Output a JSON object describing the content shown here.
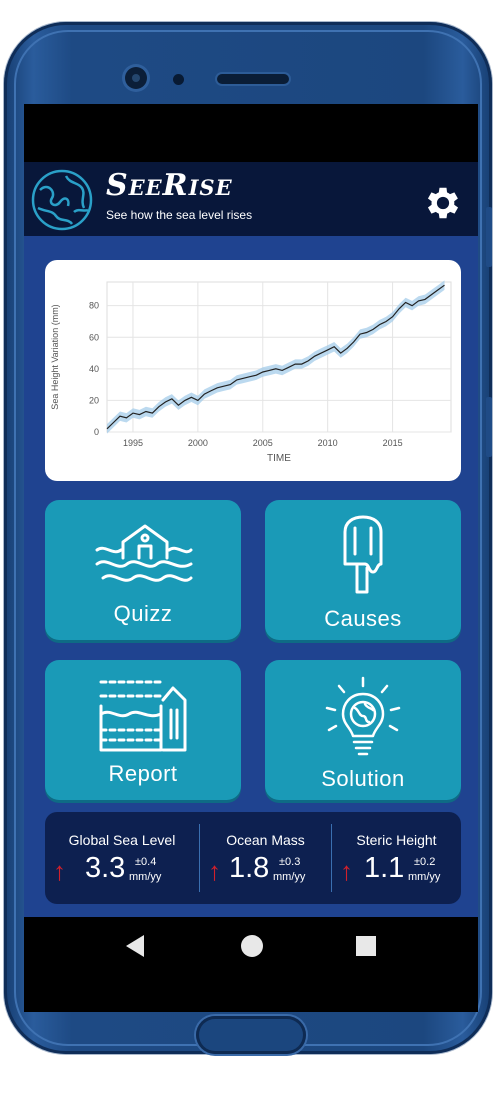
{
  "app": {
    "title": "SeeRise",
    "tagline": "See how the sea level rises",
    "accent": "#1a9ab7",
    "header_bg": "#08173a",
    "body_bg": "#1f4390"
  },
  "header": {
    "settings_icon": "gear-icon"
  },
  "chart_data": {
    "type": "line",
    "ylabel": "Sea Height Variation (mm)",
    "xlabel": "TIME",
    "xlim": [
      1993,
      2019.5
    ],
    "ylim": [
      0,
      95
    ],
    "xticks": [
      "1995",
      "2000",
      "2005",
      "2010",
      "2015"
    ],
    "yticks": [
      "0",
      "20",
      "40",
      "60",
      "80"
    ],
    "grid": true,
    "series": [
      {
        "x": [
          1993,
          1993.5,
          1994,
          1994.5,
          1995,
          1995.5,
          1996,
          1996.5,
          1997,
          1997.5,
          1998,
          1998.5,
          1999,
          1999.5,
          2000,
          2000.5,
          2001,
          2001.5,
          2002,
          2002.5,
          2003,
          2003.5,
          2004,
          2004.5,
          2005,
          2005.5,
          2006,
          2006.5,
          2007,
          2007.5,
          2008,
          2008.5,
          2009,
          2009.5,
          2010,
          2010.5,
          2011,
          2011.5,
          2012,
          2012.5,
          2013,
          2013.5,
          2014,
          2014.5,
          2015,
          2015.5,
          2016,
          2016.5,
          2017,
          2017.5,
          2018,
          2018.5,
          2019
        ],
        "values": [
          2,
          6,
          10,
          9,
          12,
          11,
          13,
          12,
          16,
          19,
          21,
          17,
          20,
          22,
          20,
          24,
          26,
          28,
          29,
          30,
          33,
          34,
          35,
          36,
          38,
          39,
          40,
          39,
          41,
          43,
          43,
          45,
          48,
          50,
          52,
          54,
          50,
          53,
          57,
          62,
          63,
          65,
          68,
          70,
          73,
          78,
          82,
          80,
          83,
          84,
          87,
          90,
          93
        ]
      }
    ]
  },
  "tiles": [
    {
      "label": "Quizz",
      "icon": "flooded-house-icon"
    },
    {
      "label": "Causes",
      "icon": "melting-popsicle-icon"
    },
    {
      "label": "Report",
      "icon": "flooded-building-icon"
    },
    {
      "label": "Solution",
      "icon": "idea-bulb-globe-icon"
    }
  ],
  "stats": [
    {
      "label": "Global Sea Level",
      "value": "3.3",
      "pm": "±0.4",
      "unit": "mm/yy"
    },
    {
      "label": "Ocean Mass",
      "value": "1.8",
      "pm": "±0.3",
      "unit": "mm/yy"
    },
    {
      "label": "Steric Height",
      "value": "1.1",
      "pm": "±0.2",
      "unit": "mm/yy"
    }
  ],
  "stat_arrow": "↑",
  "nav": {
    "back": "back-icon",
    "home": "home-icon",
    "recent": "recent-apps-icon"
  }
}
